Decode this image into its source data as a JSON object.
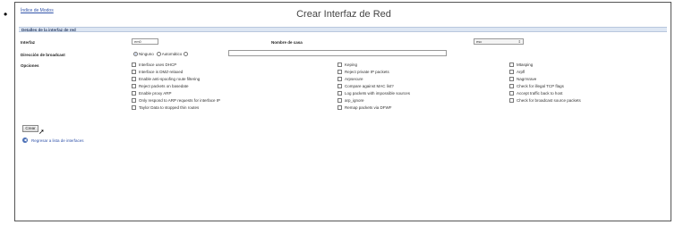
{
  "bullet": "•",
  "header": {
    "help_link": "Índice de Modos",
    "title": "Crear Interfaz de Red"
  },
  "section": {
    "title": "Detalles de la interfaz de red"
  },
  "form": {
    "interface_label": "Interfaz",
    "interface_value": "em0",
    "name_label": "Nombre de casa",
    "select_value": "esc",
    "broadcast_label": "Dirección de broadcast",
    "radio_none_label": "Ninguno",
    "radio_auto_label": "Automático",
    "options_label": "Opciones",
    "options": [
      [
        "Interface uses DHCP",
        "Interface is DMZ-relaxed",
        "Enable anti-spoofing route filtering",
        "Reject packets on basedate",
        "Enable proxy ARP",
        "Only respond to ARP requests for interface IP",
        "Taylor Data to stopped thin routes"
      ],
      [
        "Keping",
        "Reject private IP packets",
        "Arpsecure",
        "Compare against MAC list?",
        "Log packets with impossible sources",
        "arp_ignore",
        "Remap packets via DFWF"
      ],
      [
        "Mtasping",
        "Arpfl",
        "Nagrrsrave",
        "Check for illegal TCP flags",
        "Accept traffic back to host",
        "Check for broadcast source packets"
      ]
    ]
  },
  "actions": {
    "create_label": "Crear",
    "back_label": "Regresar a lista de interfaces"
  }
}
